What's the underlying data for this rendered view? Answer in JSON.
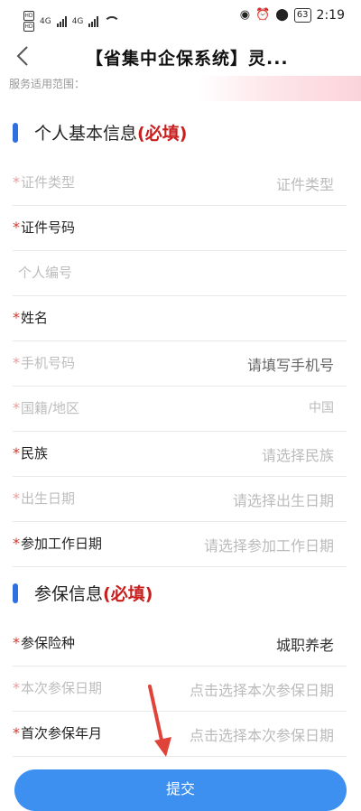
{
  "status": {
    "hd1": "HD",
    "hd2": "HD",
    "net1": "4G",
    "net2": "4G",
    "battery": "63",
    "time": "2:19"
  },
  "header": {
    "back_icon": "chevron-left-icon",
    "title": "【省集中企保系统】灵..."
  },
  "banner": {
    "text": "服务适用范围："
  },
  "sections": {
    "personal": {
      "title": "个人基本信息",
      "required": "(必填)"
    },
    "insurance": {
      "title": "参保信息",
      "required": "(必填)"
    }
  },
  "personal_fields": [
    {
      "label": "证件类型",
      "value": "证件类型",
      "star": "*"
    },
    {
      "label": "证件号码",
      "value": "",
      "star": "*"
    },
    {
      "label": "个人编号",
      "value": ""
    },
    {
      "label": "姓名",
      "value": "",
      "star": "*"
    },
    {
      "label": "手机号码",
      "value": "请填写手机号",
      "star": "*"
    },
    {
      "label": "国籍/地区",
      "value": "中国",
      "star": "*"
    },
    {
      "label": "民族",
      "value": "请选择民族",
      "star": "*"
    },
    {
      "label": "出生日期",
      "value": "请选择出生日期",
      "star": "*"
    },
    {
      "label": "参加工作日期",
      "value": "请选择参加工作日期",
      "star": "*"
    }
  ],
  "insurance_fields": [
    {
      "label": "参保险种",
      "value": "城职养老",
      "star": "*"
    },
    {
      "label": "本次参保日期",
      "value": "点击选择本次参保日期",
      "star": "*"
    },
    {
      "label": "首次参保年月",
      "value": "点击选择本次参保日期",
      "star": "*"
    }
  ],
  "submit_label": "提交",
  "colors": {
    "accent": "#3d8ff0",
    "section_bar": "#2f6fe0",
    "required": "#c81e1e",
    "arrow": "#e0433a"
  }
}
